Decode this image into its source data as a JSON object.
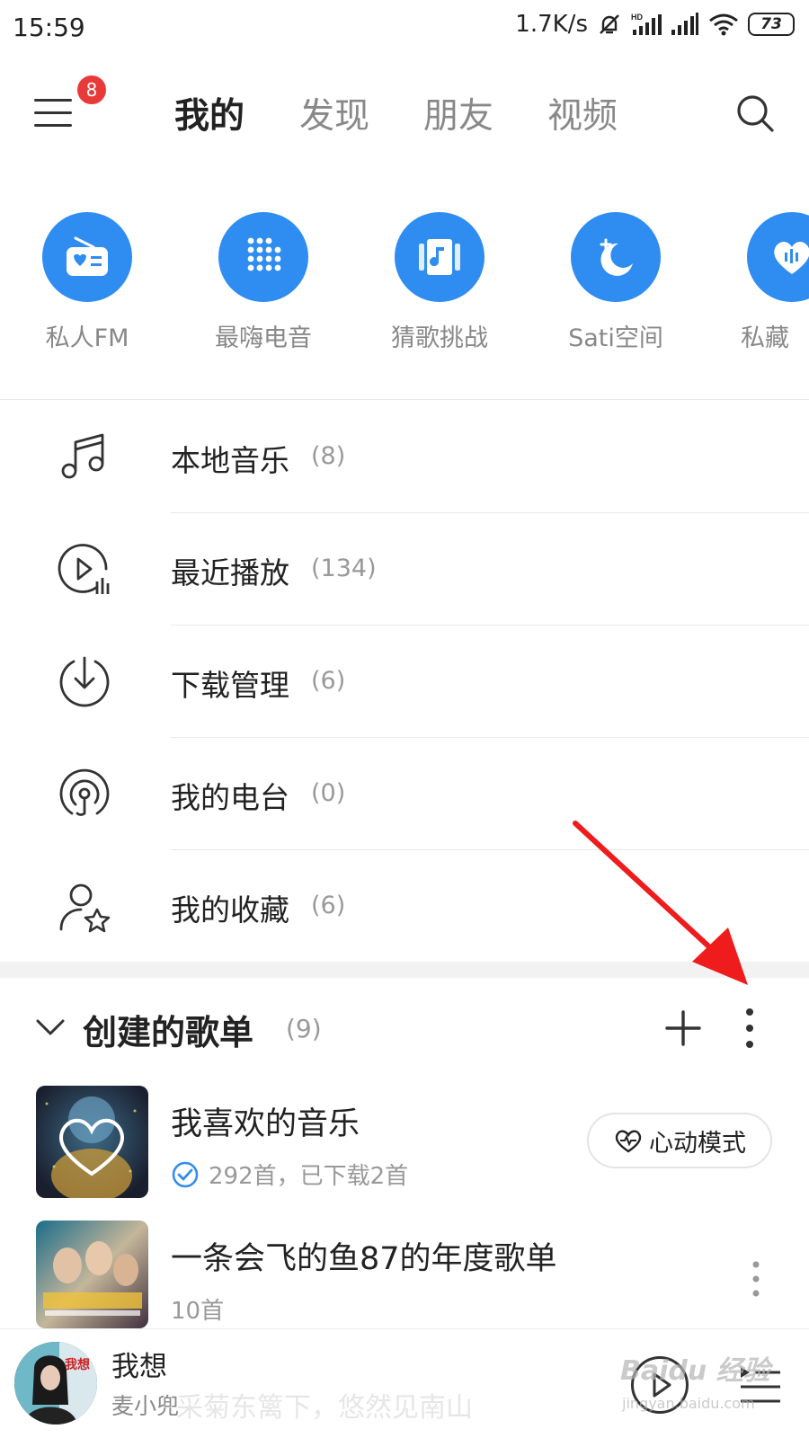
{
  "status_bar": {
    "time": "15:59",
    "speed": "1.7K/s",
    "battery": "73"
  },
  "top_nav": {
    "badge": "8",
    "tabs": [
      "我的",
      "发现",
      "朋友",
      "视频"
    ],
    "active_tab": 0
  },
  "quick_actions": [
    {
      "label": "私人FM",
      "icon": "radio-icon"
    },
    {
      "label": "最嗨电音",
      "icon": "dots-grid-icon"
    },
    {
      "label": "猜歌挑战",
      "icon": "music-card-icon"
    },
    {
      "label": "Sati空间",
      "icon": "moon-icon"
    },
    {
      "label": "私藏",
      "icon": "heart-sound-icon"
    }
  ],
  "menu_items": [
    {
      "label": "本地音乐",
      "count": "(8)",
      "icon": "music-note-icon"
    },
    {
      "label": "最近播放",
      "count": "(134)",
      "icon": "recent-play-icon"
    },
    {
      "label": "下载管理",
      "count": "(6)",
      "icon": "download-icon"
    },
    {
      "label": "我的电台",
      "count": "(0)",
      "icon": "podcast-icon"
    },
    {
      "label": "我的收藏",
      "count": "(6)",
      "icon": "user-star-icon"
    }
  ],
  "playlists_section": {
    "title": "创建的歌单",
    "count": "(9)"
  },
  "playlists": [
    {
      "name": "我喜欢的音乐",
      "subtitle": "292首，已下载2首",
      "action": "心动模式"
    },
    {
      "name": "一条会飞的鱼87的年度歌单",
      "subtitle": "10首"
    }
  ],
  "mini_player": {
    "title": "我想",
    "artist": "麦小兜",
    "lyric": "采菊东篱下，悠然见南山"
  },
  "watermark": {
    "main": "Baidu 经验",
    "sub": "jingyan.baidu.com"
  },
  "colors": {
    "accent_blue": "#2f8cf0",
    "badge_red": "#e93a3a",
    "annotation_red": "#ee1c1c"
  }
}
